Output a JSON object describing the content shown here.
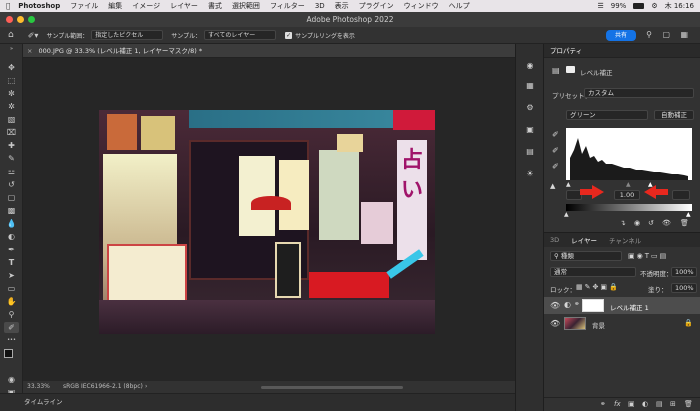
{
  "menubar": {
    "app": "Photoshop",
    "items": [
      "ファイル",
      "編集",
      "イメージ",
      "レイヤー",
      "書式",
      "選択範囲",
      "フィルター",
      "3D",
      "表示",
      "プラグイン",
      "ウィンドウ",
      "ヘルプ"
    ],
    "battery": "99%",
    "clock": "木 16:16"
  },
  "window": {
    "title": "Adobe Photoshop 2022"
  },
  "options": {
    "sample_size_label": "サンプル範囲：",
    "sample_size_value": "指定したピクセル",
    "sample_label": "サンプル：",
    "sample_value": "すべてのレイヤー",
    "sample_ring_label": "サンプルリングを表示",
    "share_label": "共有"
  },
  "document": {
    "tab_title": "000.JPG @ 33.3% (レベル補正 1, レイヤーマスク/8) *",
    "zoom": "33.33%",
    "profile": "sRGB IEC61966-2.1 (8bpc)"
  },
  "timeline": {
    "label": "タイムライン"
  },
  "properties": {
    "title": "プロパティ",
    "adjustment_name": "レベル補正",
    "preset_label": "プリセット：",
    "preset_value": "カスタム",
    "channel_value": "グリーン",
    "auto_label": "自動補正",
    "midtone_value": "1.00"
  },
  "layers_panel": {
    "tabs": [
      "3D",
      "レイヤー",
      "チャンネル"
    ],
    "active_tab": "レイヤー",
    "filter_label": "種類",
    "blend_mode": "通常",
    "opacity_label": "不透明度：",
    "opacity_value": "100%",
    "lock_label": "ロック：",
    "fill_label": "塗り：",
    "fill_value": "100%",
    "layers": [
      {
        "name": "レベル補正 1",
        "type": "adjustment"
      },
      {
        "name": "背景",
        "type": "background"
      }
    ]
  },
  "colors": {
    "accent": "#1473e6",
    "annotation_arrow": "#e8281e",
    "panel_bg": "#323232",
    "canvas_bg": "#262626"
  }
}
